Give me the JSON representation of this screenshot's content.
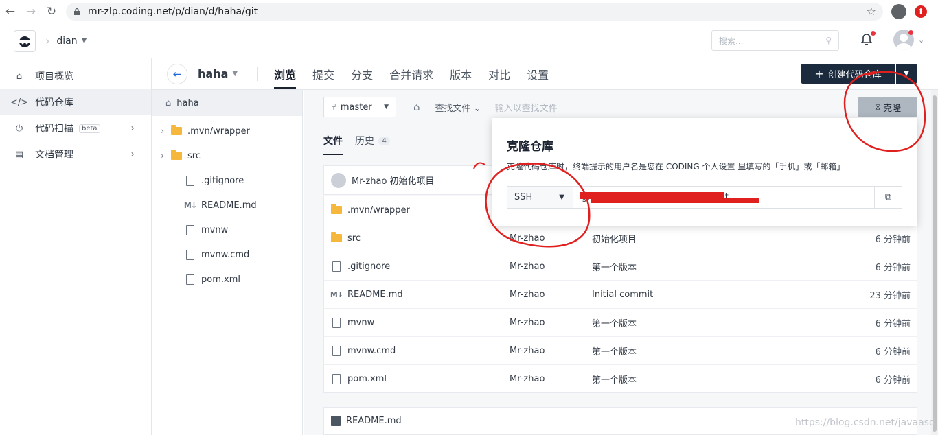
{
  "browser": {
    "url": "mr-zlp.coding.net/p/dian/d/haha/git"
  },
  "header": {
    "team": "dian",
    "search_placeholder": "搜索..."
  },
  "leftnav": {
    "items": [
      {
        "label": "项目概览",
        "icon": "home-icon"
      },
      {
        "label": "代码仓库",
        "icon": "code-icon"
      },
      {
        "label": "代码扫描",
        "icon": "scan-icon",
        "badge": "beta"
      },
      {
        "label": "文档管理",
        "icon": "doc-icon"
      }
    ]
  },
  "subheader": {
    "repo": "haha",
    "tabs": [
      "浏览",
      "提交",
      "分支",
      "合并请求",
      "版本",
      "对比",
      "设置"
    ],
    "create_label": "创建代码仓库"
  },
  "tree": {
    "root": "haha",
    "nodes": [
      {
        "name": ".mvn/wrapper",
        "type": "folder"
      },
      {
        "name": "src",
        "type": "folder"
      },
      {
        "name": ".gitignore",
        "type": "file"
      },
      {
        "name": "README.md",
        "type": "md"
      },
      {
        "name": "mvnw",
        "type": "file"
      },
      {
        "name": "mvnw.cmd",
        "type": "file"
      },
      {
        "name": "pom.xml",
        "type": "file"
      }
    ]
  },
  "toolbar": {
    "branch": "master",
    "find_label": "查找文件",
    "find_placeholder": "输入以查找文件",
    "clone_label": "克隆"
  },
  "file_tabs": {
    "files": "文件",
    "history": "历史",
    "history_count": "4"
  },
  "commit": {
    "text": "Mr-zhao 初始化项目"
  },
  "files": [
    {
      "name": ".mvn/wrapper",
      "type": "folder",
      "author": "",
      "message": "",
      "time": ""
    },
    {
      "name": "src",
      "type": "folder",
      "author": "Mr-zhao",
      "message": "初始化项目",
      "time": "6 分钟前"
    },
    {
      "name": ".gitignore",
      "type": "file",
      "author": "Mr-zhao",
      "message": "第一个版本",
      "time": "6 分钟前"
    },
    {
      "name": "README.md",
      "type": "md",
      "author": "Mr-zhao",
      "message": "Initial commit",
      "time": "23 分钟前"
    },
    {
      "name": "mvnw",
      "type": "file",
      "author": "Mr-zhao",
      "message": "第一个版本",
      "time": "6 分钟前"
    },
    {
      "name": "mvnw.cmd",
      "type": "file",
      "author": "Mr-zhao",
      "message": "第一个版本",
      "time": "6 分钟前"
    },
    {
      "name": "pom.xml",
      "type": "file",
      "author": "Mr-zhao",
      "message": "第一个版本",
      "time": "6 分钟前"
    }
  ],
  "readme": {
    "title": "README.md"
  },
  "clone_popover": {
    "title": "克隆仓库",
    "desc": "克隆代码仓库时，终端提示的用户名是您在 CODING 个人设置 里填写的「手机」或「邮箱」",
    "protocol": "SSH",
    "url": "git@e.coding.net:mr-zlp/haha.git"
  },
  "watermark": "https://blog.csdn.net/javaasd",
  "colors": {
    "accent": "#1e6bde",
    "primary_button": "#1b2b3d",
    "annotation": "#e0201f"
  }
}
